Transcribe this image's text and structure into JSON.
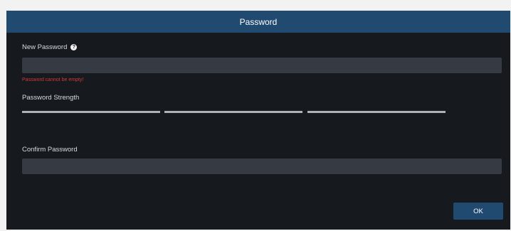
{
  "dialog": {
    "title": "Password",
    "new_password": {
      "label": "New Password",
      "help_icon": "question-circle-icon",
      "value": "",
      "placeholder": "",
      "error": "Password cannot be empty!"
    },
    "strength": {
      "label": "Password Strength",
      "segments": 3
    },
    "confirm_password": {
      "label": "Confirm Password",
      "value": "",
      "placeholder": ""
    },
    "ok_label": "OK"
  },
  "colors": {
    "title_bar": "#214a71",
    "background": "#16191e",
    "input": "#363a42",
    "error": "#cf3b3b",
    "strength_bar": "#aeb2b8"
  }
}
